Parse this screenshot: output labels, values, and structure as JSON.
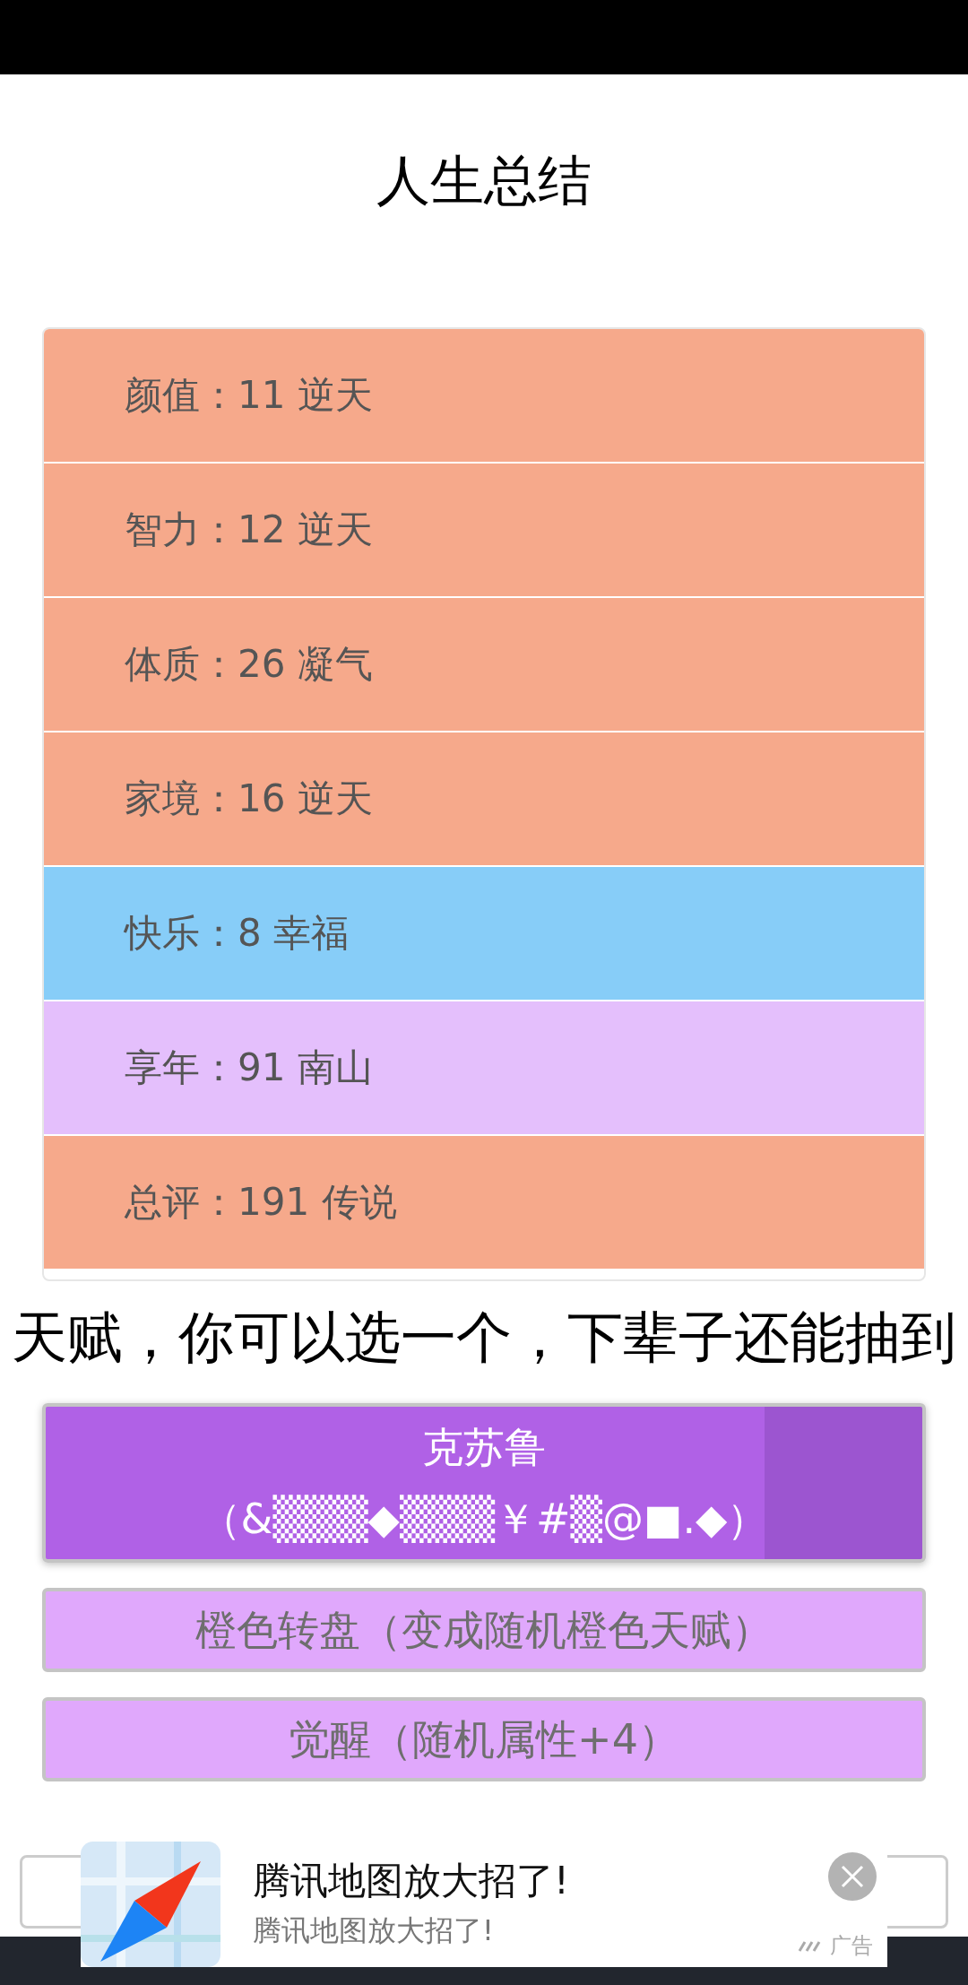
{
  "title": "人生总结",
  "stats": [
    {
      "text": "颜值：11 逆天",
      "color": "#f6a98b"
    },
    {
      "text": "智力：12 逆天",
      "color": "#f6a98b"
    },
    {
      "text": "体质：26 凝气",
      "color": "#f6a98b"
    },
    {
      "text": "家境：16 逆天",
      "color": "#f6a98b"
    },
    {
      "text": "快乐：8 幸福",
      "color": "#87cdf8"
    },
    {
      "text": "享年：91 南山",
      "color": "#e4bffc"
    },
    {
      "text": "总评：191 传说",
      "color": "#f6a98b"
    }
  ],
  "heading": "天赋，你可以选一个，下辈子还能抽到",
  "talents": [
    {
      "name": "克苏鲁",
      "note": "（&▒▒▒◆▒▒▒￥#▒@■.◆）",
      "selected": true
    },
    {
      "name": "橙色转盘（变成随机橙色天赋）",
      "selected": false
    },
    {
      "name": "觉醒（随机属性+4）",
      "selected": false
    }
  ],
  "ad": {
    "title": "腾讯地图放大招了!",
    "subtitle": "腾讯地图放大招了!",
    "badge": "广告"
  }
}
